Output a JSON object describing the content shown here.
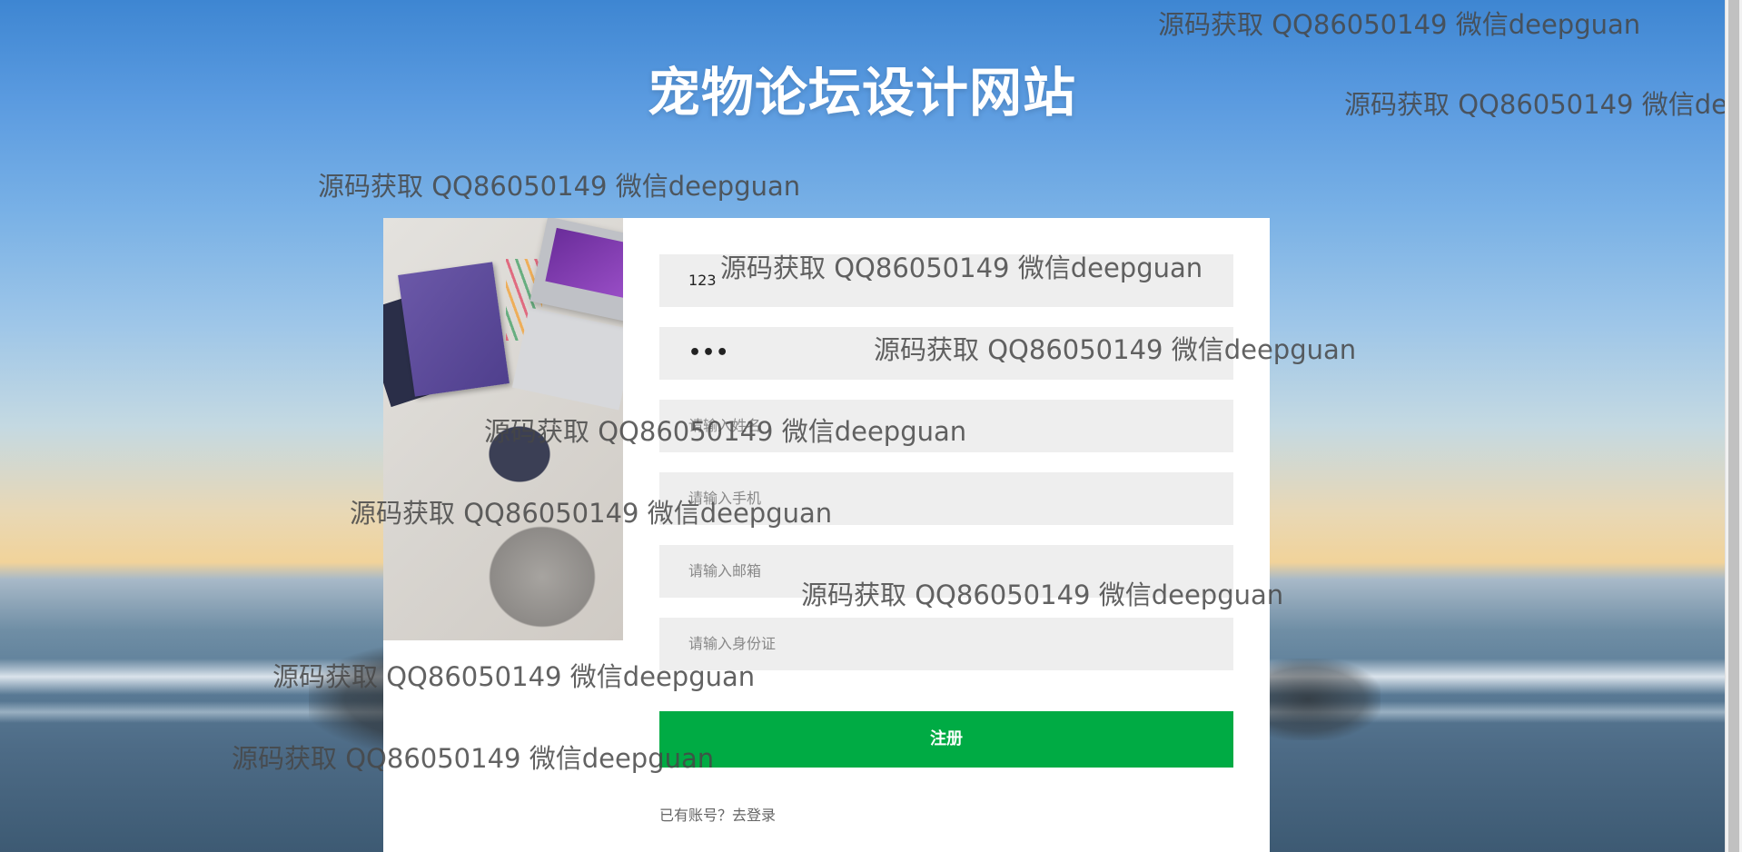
{
  "site_title": "宠物论坛设计网站",
  "form": {
    "username_value": "123",
    "password_value": "•••",
    "name_placeholder": "请输入姓名",
    "phone_placeholder": "请输入手机",
    "email_placeholder": "请输入邮箱",
    "idcard_placeholder": "请输入身份证",
    "submit_label": "注册",
    "login_link": "已有账号？去登录"
  },
  "watermark_text": "源码获取 QQ86050149 微信deepguan"
}
